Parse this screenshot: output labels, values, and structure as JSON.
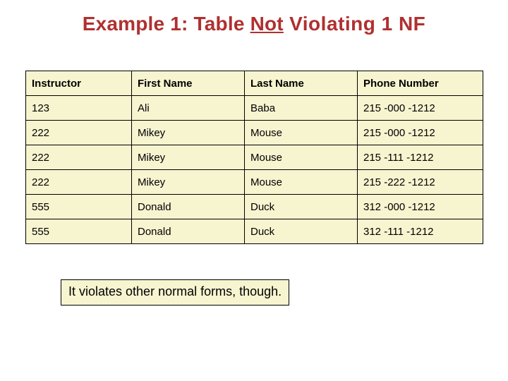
{
  "title": {
    "pre": "Example 1: Table ",
    "not": "Not",
    "post": " Violating 1 NF"
  },
  "table": {
    "headers": [
      "Instructor",
      "First Name",
      "Last Name",
      "Phone Number"
    ],
    "rows": [
      [
        "123",
        "Ali",
        "Baba",
        "215 -000 -1212"
      ],
      [
        "222",
        "Mikey",
        "Mouse",
        "215 -000 -1212"
      ],
      [
        "222",
        "Mikey",
        "Mouse",
        "215 -111 -1212"
      ],
      [
        "222",
        "Mikey",
        "Mouse",
        "215 -222 -1212"
      ],
      [
        "555",
        "Donald",
        "Duck",
        "312 -000 -1212"
      ],
      [
        "555",
        "Donald",
        "Duck",
        "312 -111 -1212"
      ]
    ]
  },
  "note": "It violates other normal forms, though."
}
